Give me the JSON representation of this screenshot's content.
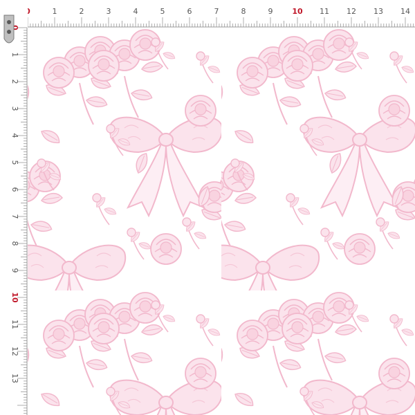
{
  "ruler": {
    "top_labels": [
      "0",
      "1",
      "2",
      "3",
      "4",
      "5",
      "6",
      "7",
      "8",
      "9",
      "10",
      "11",
      "12",
      "13",
      "14"
    ],
    "left_labels": [
      "0",
      "1",
      "2",
      "3",
      "4",
      "5",
      "6",
      "7",
      "8",
      "9",
      "10",
      "11",
      "12",
      "13"
    ],
    "highlight_label": "10",
    "label_color": "#555555",
    "highlight_color": "#c0182a",
    "tick_color": "#999999"
  },
  "pattern": {
    "background": "#ffffff",
    "line_color": "#f2b8cc",
    "fill_color": "#fbe3ec",
    "motifs": [
      "bow",
      "peony-bouquet",
      "rose-bouquet",
      "leaf-sprig",
      "bud-sprig"
    ]
  },
  "icons": {
    "clip": "binder-clip-icon"
  }
}
